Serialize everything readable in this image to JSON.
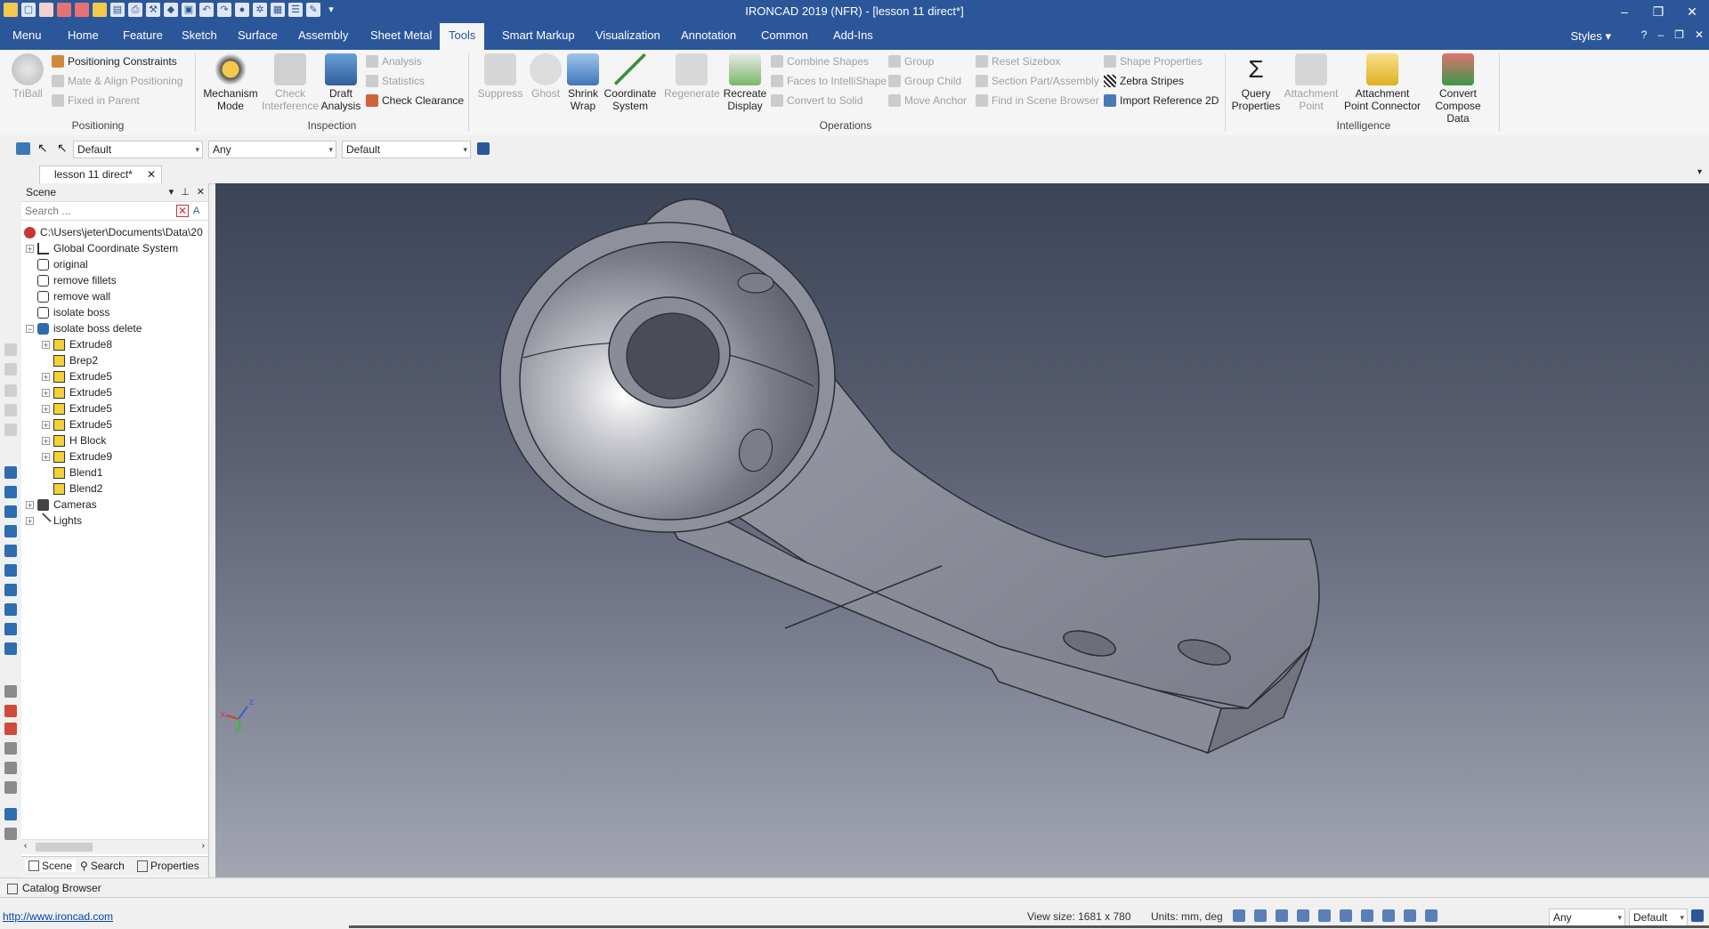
{
  "window": {
    "title": "IRONCAD 2019 (NFR) - [lesson 11 direct*]",
    "controls": [
      "–",
      "❐",
      "✕"
    ]
  },
  "ribbon_tabs": [
    "Menu",
    "Home",
    "Feature",
    "Sketch",
    "Surface",
    "Assembly",
    "Sheet Metal",
    "Tools",
    "Smart Markup",
    "Visualization",
    "Annotation",
    "Common",
    "Add-Ins"
  ],
  "active_tab": "Tools",
  "styles_label": "Styles",
  "groups": {
    "positioning": {
      "label": "Positioning",
      "triball": "TriBall",
      "items": [
        "Positioning Constraints",
        "Mate & Align Positioning",
        "Fixed in Parent"
      ]
    },
    "inspection": {
      "label": "Inspection",
      "mechanism": [
        "Mechanism",
        "Mode"
      ],
      "check_interference": [
        "Check",
        "Interference"
      ],
      "draft_analysis": [
        "Draft",
        "Analysis"
      ],
      "items": [
        "Analysis",
        "Statistics",
        "Check Clearance"
      ]
    },
    "operations": {
      "label": "Operations",
      "suppress": "Suppress",
      "ghost": "Ghost",
      "shrink_wrap": [
        "Shrink",
        "Wrap"
      ],
      "coordinate_system": [
        "Coordinate",
        "System"
      ],
      "regenerate": "Regenerate",
      "recreate_display": [
        "Recreate",
        "Display"
      ],
      "col1": [
        "Combine Shapes",
        "Faces to IntelliShape",
        "Convert to Solid"
      ],
      "col2": [
        "Group",
        "Group Child",
        "Move Anchor"
      ],
      "col3": [
        "Reset Sizebox",
        "Section Part/Assembly",
        "Find in Scene Browser"
      ],
      "col4": [
        "Shape Properties",
        "Zebra Stripes",
        "Import Reference 2D"
      ]
    },
    "intelligence": {
      "label": "Intelligence",
      "query_properties": [
        "Query",
        "Properties"
      ],
      "attachment_point": [
        "Attachment",
        "Point"
      ],
      "attachment_point_connector": [
        "Attachment",
        "Point Connector"
      ],
      "convert_compose": [
        "Convert",
        "Compose Data"
      ]
    }
  },
  "toolbar2": {
    "combo1": "Default",
    "combo2": "Any",
    "combo3": "Default"
  },
  "doc_tab": "lesson 11 direct*",
  "scene": {
    "title": "Scene",
    "search_placeholder": "Search ...",
    "tree": [
      {
        "label": "C:\\Users\\jeter\\Documents\\Data\\20",
        "level": 0
      },
      {
        "label": "Global Coordinate System",
        "level": 1
      },
      {
        "label": "original",
        "level": 1
      },
      {
        "label": "remove fillets",
        "level": 1
      },
      {
        "label": "remove wall",
        "level": 1
      },
      {
        "label": "isolate boss",
        "level": 1
      },
      {
        "label": "isolate boss delete",
        "level": 1
      },
      {
        "label": "Extrude8",
        "level": 2
      },
      {
        "label": "Brep2",
        "level": 2
      },
      {
        "label": "Extrude5",
        "level": 2
      },
      {
        "label": "Extrude5",
        "level": 2
      },
      {
        "label": "Extrude5",
        "level": 2
      },
      {
        "label": "Extrude5",
        "level": 2
      },
      {
        "label": "H Block",
        "level": 2
      },
      {
        "label": "Extrude9",
        "level": 2
      },
      {
        "label": "Blend1",
        "level": 2
      },
      {
        "label": "Blend2",
        "level": 2
      },
      {
        "label": "Cameras",
        "level": 1
      },
      {
        "label": "Lights",
        "level": 1
      }
    ],
    "bottom_tabs": [
      "Scene",
      "Search",
      "Properties"
    ]
  },
  "axis_labels": {
    "x": "x",
    "y": "y",
    "z": "z"
  },
  "catalog_browser": "Catalog Browser",
  "status": {
    "url": "http://www.ironcad.com",
    "view_size": "View size: 1681 x 780",
    "units": "Units: mm, deg",
    "combo_any": "Any",
    "combo_default": "Default"
  },
  "colors": {
    "accent": "#2b579a",
    "viewport_top": "#3d4457",
    "viewport_bottom": "#a3a6b1",
    "part": "#8f929e"
  }
}
